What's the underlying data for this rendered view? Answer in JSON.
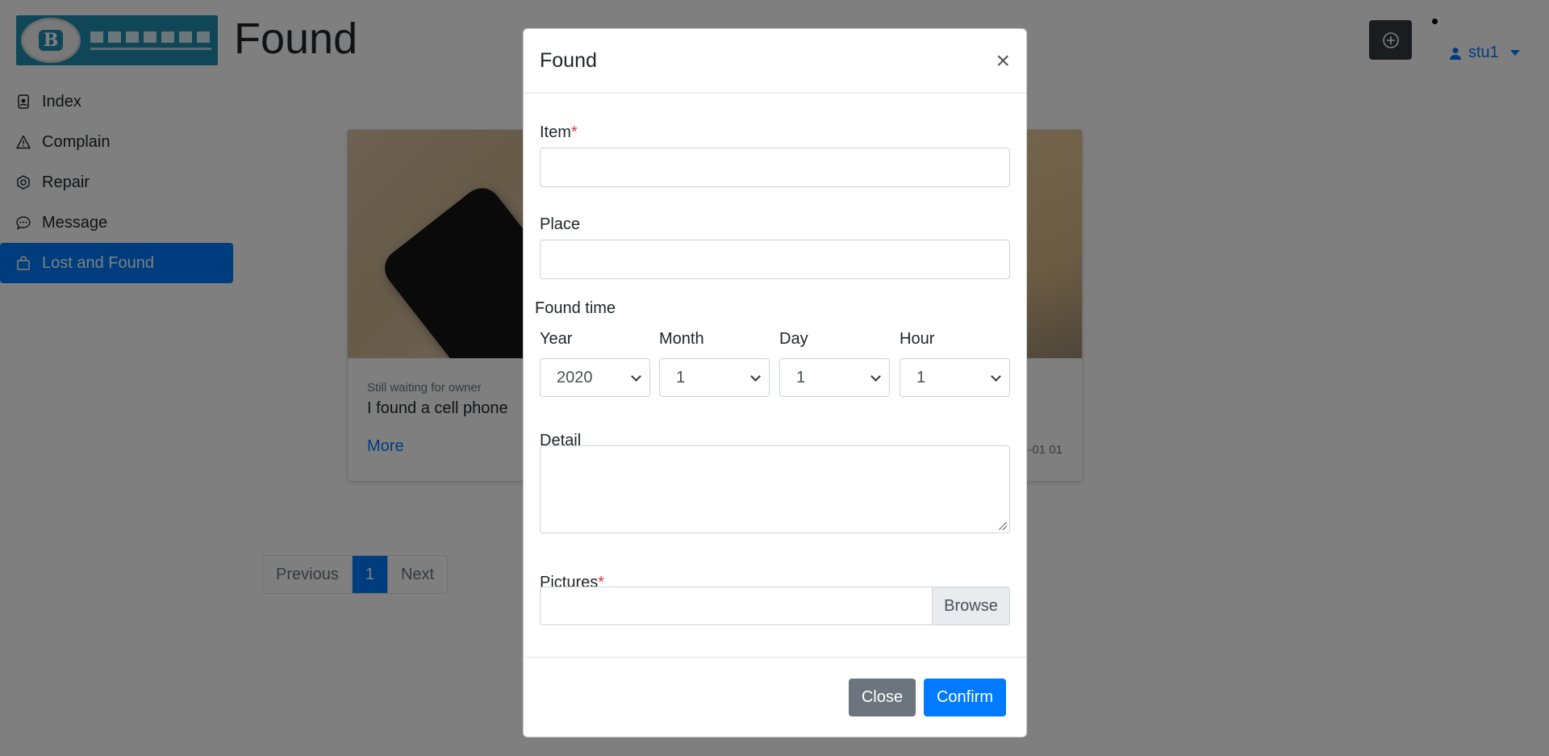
{
  "page": {
    "title": "Found"
  },
  "header": {
    "user_name": "stu1"
  },
  "sidebar": {
    "items": [
      {
        "label": "Index",
        "icon": "id-badge-icon"
      },
      {
        "label": "Complain",
        "icon": "warning-icon"
      },
      {
        "label": "Repair",
        "icon": "gear-icon"
      },
      {
        "label": "Message",
        "icon": "chat-icon"
      },
      {
        "label": "Lost and Found",
        "icon": "bag-icon",
        "active": true
      }
    ]
  },
  "cards": [
    {
      "status": "Still waiting for owner",
      "title": "I found a cell phone",
      "more": "More"
    },
    {
      "date": "-01 01"
    }
  ],
  "pagination": {
    "previous": "Previous",
    "current": "1",
    "next": "Next"
  },
  "modal": {
    "title": "Found",
    "close_symbol": "×",
    "item_label": "Item",
    "place_label": "Place",
    "found_time_label": "Found time",
    "year_label": "Year",
    "year_value": "2020",
    "month_label": "Month",
    "month_value": "1",
    "day_label": "Day",
    "day_value": "1",
    "hour_label": "Hour",
    "hour_value": "1",
    "detail_label": "Detail",
    "pictures_label": "Pictures",
    "required_mark": "*",
    "browse_label": "Browse",
    "close_button": "Close",
    "confirm_button": "Confirm"
  },
  "colors": {
    "primary": "#007bff",
    "secondary": "#6c757d",
    "dark": "#343a40",
    "required": "#dc3545"
  }
}
